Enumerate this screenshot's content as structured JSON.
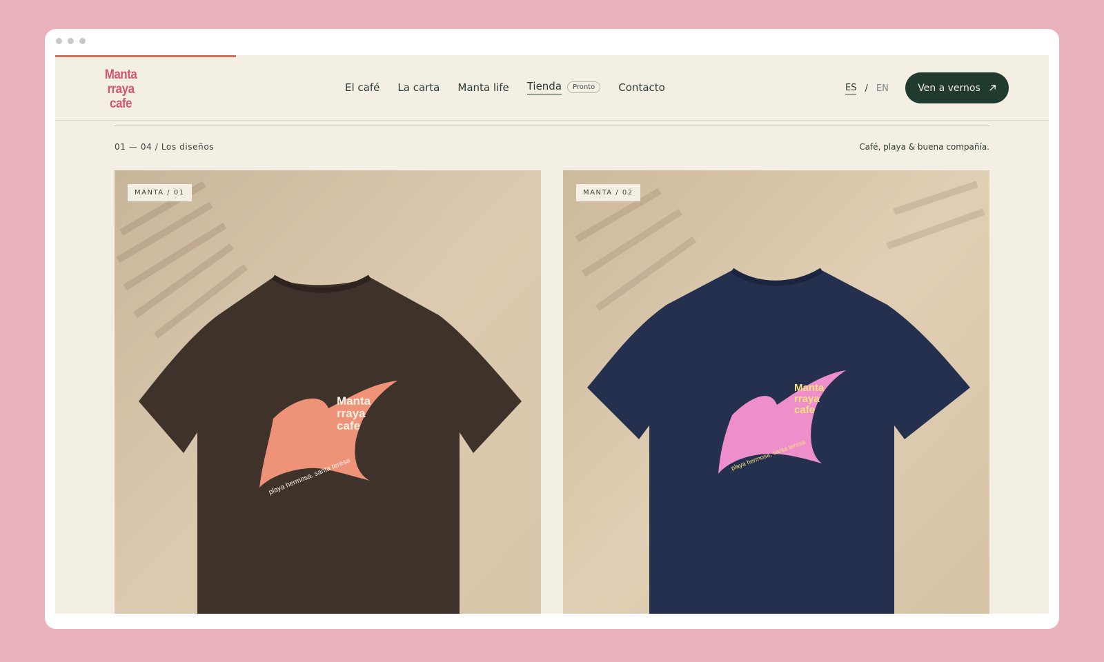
{
  "window": {
    "dots": 3
  },
  "header": {
    "logo_lines": [
      "Manta",
      "rraya",
      "cafe"
    ],
    "nav": [
      {
        "label": "El café"
      },
      {
        "label": "La carta"
      },
      {
        "label": "Manta life"
      },
      {
        "label": "Tienda",
        "badge": "Pronto",
        "active": true
      },
      {
        "label": "Contacto"
      }
    ],
    "lang": {
      "es": "ES",
      "separator": "/",
      "en": "EN",
      "selected": "ES"
    },
    "cta_label": "Ven a vernos"
  },
  "section": {
    "counter": "01 — 04 / Los diseños",
    "tagline": "Café, playa & buena compañía."
  },
  "products": [
    {
      "tag": "MANTA / 01",
      "shirt_color": "#3e322b",
      "print_color": "#ef9378",
      "logo_color": "#f4efe4",
      "print_text": "playa hermosa, santa teresa"
    },
    {
      "tag": "MANTA / 02",
      "shirt_color": "#25304f",
      "print_color": "#ee8fcb",
      "logo_color": "#f6e07e",
      "print_text": "playa hermosa, santa teresa"
    }
  ],
  "colors": {
    "accent": "#213a2e",
    "background": "#f4efe4",
    "brand": "#d3566d",
    "progress": "#c8735a"
  }
}
